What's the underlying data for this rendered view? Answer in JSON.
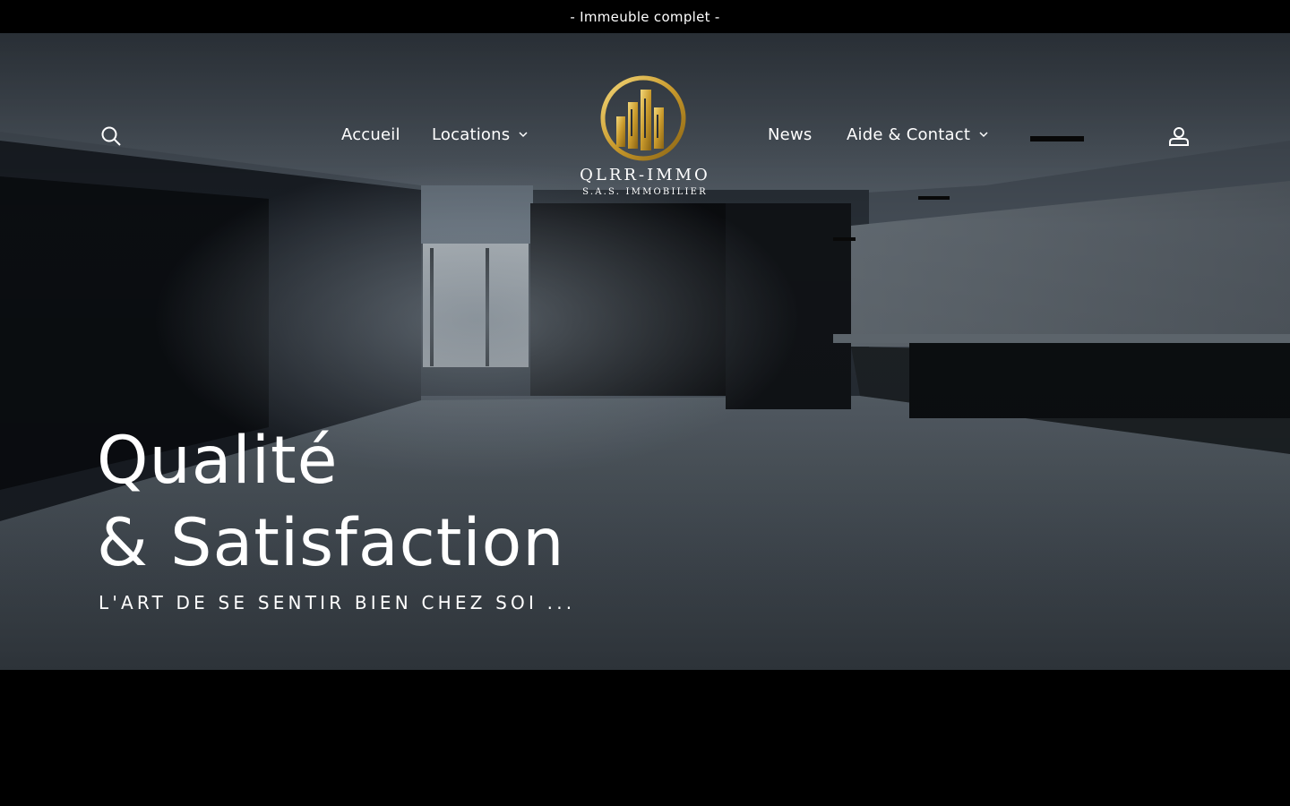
{
  "announcement": {
    "text": "- Immeuble complet -"
  },
  "header": {
    "search_icon": "search-icon",
    "account_icon": "user-icon",
    "nav_left": [
      {
        "label": "Accueil",
        "has_dropdown": false
      },
      {
        "label": "Locations",
        "has_dropdown": true
      }
    ],
    "nav_right": [
      {
        "label": "News",
        "has_dropdown": false
      },
      {
        "label": "Aide & Contact",
        "has_dropdown": true
      }
    ],
    "logo": {
      "name": "QLRR-IMMO",
      "subtitle": "S.A.S. IMMOBILIER",
      "icon": "buildings-ring-logo"
    }
  },
  "hero": {
    "title_line1": "Qualité",
    "title_line2": "& Satisfaction",
    "subtitle": "L'ART DE SE SENTIR BIEN CHEZ SOI ..."
  },
  "colors": {
    "background": "#000000",
    "text": "#ffffff",
    "logo_gold": "#d4a93a"
  }
}
